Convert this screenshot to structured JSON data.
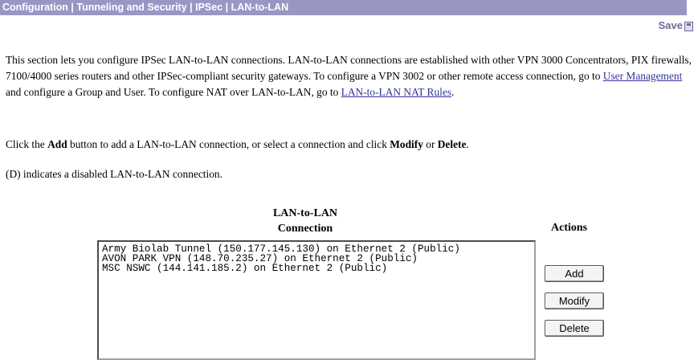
{
  "breadcrumb": "Configuration | Tunneling and Security | IPSec | LAN-to-LAN",
  "save": {
    "label": "Save",
    "icon": "save-icon"
  },
  "intro": {
    "t1": "This section lets you configure IPSec LAN-to-LAN connections. LAN-to-LAN connections are established with other VPN 3000 Concentrators, PIX firewalls, 7100/4000 series routers and other IPSec-compliant security gateways. To configure a VPN 3002 or other remote access connection, go to ",
    "link1": "User Management",
    "t2": " and configure a Group and User. To configure NAT over LAN-to-LAN, go to ",
    "link2": "LAN-to-LAN NAT Rules",
    "t3": "."
  },
  "instructions": {
    "t1": "Click the ",
    "add": "Add",
    "t2": " button to add a LAN-to-LAN connection, or select a connection and click ",
    "modify": "Modify",
    "t3": " or ",
    "delete": "Delete",
    "t4": "."
  },
  "disabled_note": "(D) indicates a disabled LAN-to-LAN connection.",
  "connection_list": {
    "header_line1": "LAN-to-LAN",
    "header_line2": "Connection",
    "items": [
      "Army Biolab Tunnel (150.177.145.130) on Ethernet 2 (Public)",
      "AVON PARK VPN (148.70.235.27) on Ethernet 2 (Public)",
      "MSC NSWC (144.141.185.2) on Ethernet 2 (Public)"
    ]
  },
  "actions": {
    "header": "Actions",
    "add": "Add",
    "modify": "Modify",
    "delete": "Delete"
  },
  "colors": {
    "titlebar": "#9a96c4",
    "save": "#6d6a98",
    "link": "#333399"
  }
}
